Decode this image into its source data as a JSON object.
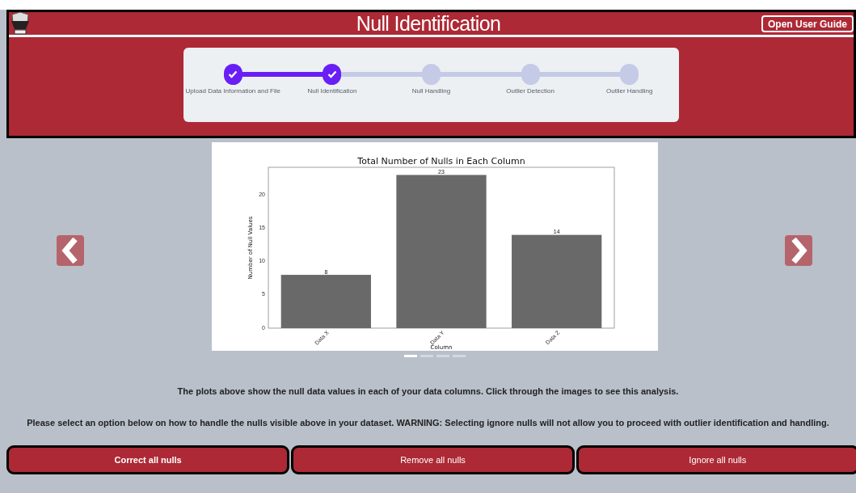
{
  "header": {
    "title": "Null Identification",
    "guide_button": "Open User Guide"
  },
  "steps": [
    {
      "label": "Upload Data Information and File",
      "completed": true
    },
    {
      "label": "Null Identification",
      "completed": true
    },
    {
      "label": "Null Handling",
      "completed": false
    },
    {
      "label": "Outlier Detection",
      "completed": false
    },
    {
      "label": "Outlier Handling",
      "completed": false
    }
  ],
  "carousel": {
    "slides": [
      {
        "selected": true
      },
      {
        "selected": false
      },
      {
        "selected": false
      },
      {
        "selected": false
      }
    ],
    "chart_data": {
      "type": "bar",
      "title": "Total Number of Nulls in Each Column",
      "xlabel": "Column",
      "ylabel": "Number of Null Values",
      "categories": [
        "Data X",
        "Data Y",
        "Data Z"
      ],
      "series": [
        {
          "color": "#696969",
          "values": [
            8,
            23,
            14
          ]
        }
      ],
      "ylim": [
        0,
        24.15
      ],
      "yticks": [
        0,
        5,
        10,
        15,
        20
      ],
      "data_labels": true
    }
  },
  "description": "The plots above show the null data values in each of your data columns. Click through the images to see this analysis.",
  "instruction": "Please select an option below on how to handle the nulls visible above in your dataset. WARNING: Selecting ignore nulls will not allow you to proceed with outlier identification and handling.",
  "options": [
    {
      "label": "Correct all nulls",
      "selected": true
    },
    {
      "label": "Remove all nulls",
      "selected": false
    },
    {
      "label": "Ignore all nulls",
      "selected": false
    }
  ]
}
